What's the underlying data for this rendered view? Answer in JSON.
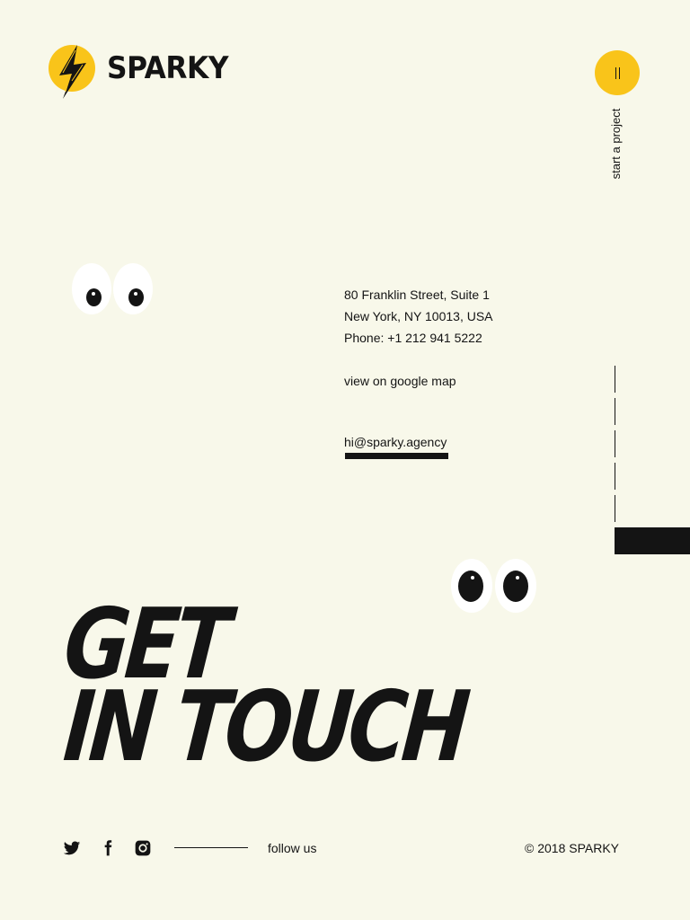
{
  "brand": {
    "name": "SPARKY",
    "logo_icon": "lightning-bolt-icon"
  },
  "header": {
    "start_project_label": "start a project",
    "start_project_icon": "pause-lines-icon"
  },
  "contact": {
    "address_line1": "80 Franklin Street, Suite 1",
    "address_line2": "New York, NY 10013, USA",
    "phone": "Phone: +1 212 941 5222",
    "map_link": "view on google map",
    "email": "hi@sparky.agency"
  },
  "headline": {
    "line1": "GET",
    "line2": "IN TOUCH"
  },
  "footer": {
    "social": [
      "twitter-icon",
      "facebook-icon",
      "instagram-icon"
    ],
    "follow_label": "follow us",
    "copyright": "© 2018 SPARKY"
  },
  "colors": {
    "background": "#f8f8ea",
    "accent": "#f9c41a",
    "ink": "#141414"
  }
}
